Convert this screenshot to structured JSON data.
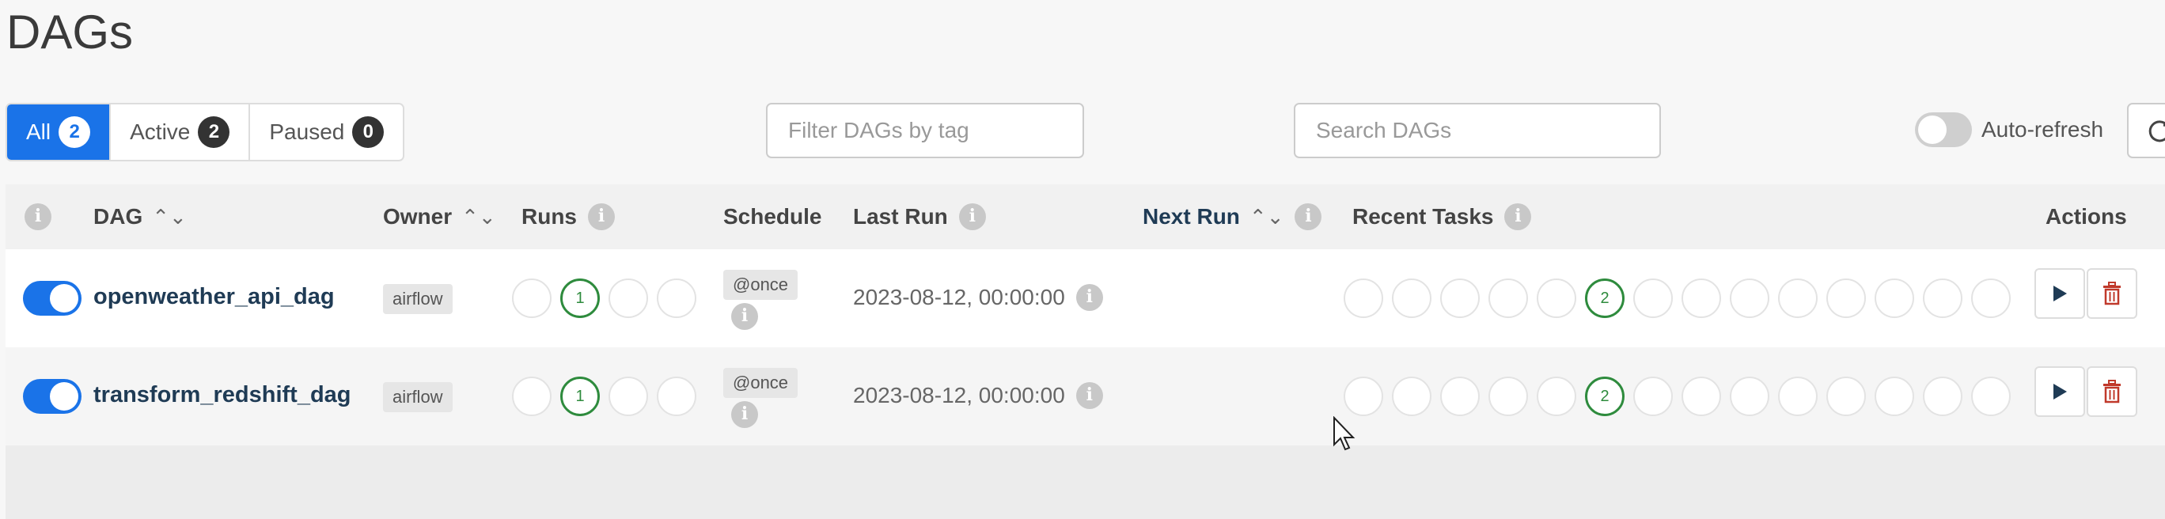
{
  "page": {
    "title": "DAGs"
  },
  "filters": {
    "tabs": [
      {
        "label": "All",
        "count": "2"
      },
      {
        "label": "Active",
        "count": "2"
      },
      {
        "label": "Paused",
        "count": "0"
      }
    ],
    "tag_placeholder": "Filter DAGs by tag",
    "search_placeholder": "Search DAGs",
    "auto_refresh_label": "Auto-refresh"
  },
  "table": {
    "headers": {
      "dag": "DAG",
      "owner": "Owner",
      "runs": "Runs",
      "schedule": "Schedule",
      "last_run": "Last Run",
      "next_run": "Next Run",
      "recent_tasks": "Recent Tasks",
      "actions": "Actions"
    },
    "rows": [
      {
        "name": "openweather_api_dag",
        "owner": "airflow",
        "runs_success": "1",
        "schedule": "@once",
        "last_run": "2023-08-12, 00:00:00",
        "recent_success": "2",
        "paused": false
      },
      {
        "name": "transform_redshift_dag",
        "owner": "airflow",
        "runs_success": "1",
        "schedule": "@once",
        "last_run": "2023-08-12, 00:00:00",
        "recent_success": "2",
        "paused": false
      }
    ]
  },
  "colors": {
    "primary": "#1a73e8",
    "success": "#2e8b3d",
    "delete": "#c0392b"
  },
  "icons": {
    "trigger": "play-icon",
    "delete": "trash-icon",
    "refresh": "refresh-icon",
    "sort": "sort-icon",
    "info": "info-icon"
  }
}
